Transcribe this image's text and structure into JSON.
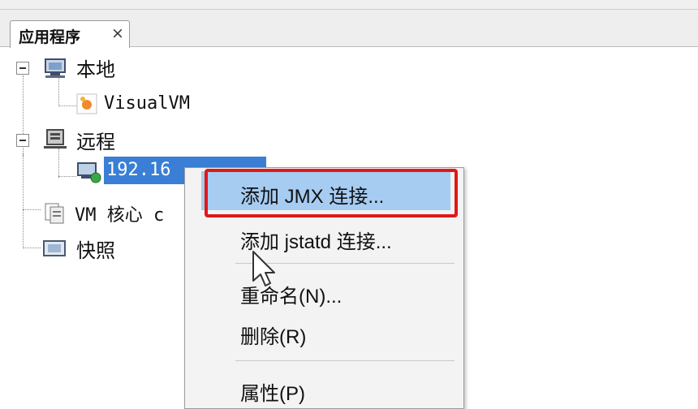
{
  "tab": {
    "label": "应用程序",
    "close": "×"
  },
  "tree": {
    "local": {
      "label": "本地"
    },
    "visualvm": {
      "label": "VisualVM"
    },
    "remote": {
      "label": "远程"
    },
    "host": {
      "label": "192.16"
    },
    "coredumps": {
      "label": "VM 核心 c"
    },
    "snapshots": {
      "label": "快照"
    }
  },
  "menu": {
    "items": [
      {
        "label": "添加 JMX 连接..."
      },
      {
        "label": "添加 jstatd 连接..."
      },
      {
        "label": "重命名(N)..."
      },
      {
        "label": "删除(R)"
      },
      {
        "label": "属性(P)"
      }
    ]
  },
  "colors": {
    "selection": "#3a7fd5",
    "hover": "#a6ccf2",
    "highlight_border": "#e01818"
  }
}
